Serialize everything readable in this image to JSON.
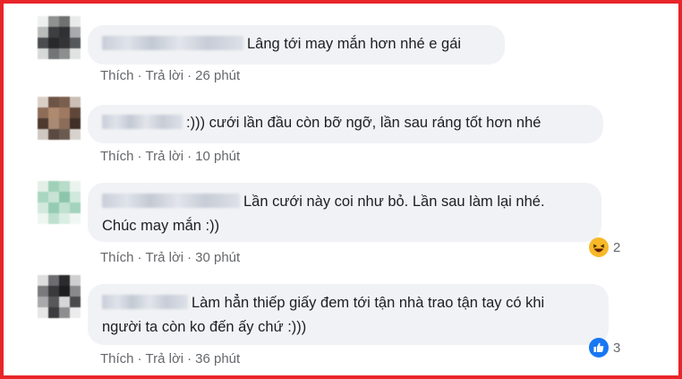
{
  "comments": [
    {
      "text": "Lâng tới may mắn hơn nhé e gái",
      "actions": {
        "like": "Thích",
        "reply": "Trả lời",
        "time": "26 phút"
      }
    },
    {
      "text": ":))) cưới lần đầu còn bỡ ngỡ, lần sau ráng tốt hơn nhé",
      "actions": {
        "like": "Thích",
        "reply": "Trả lời",
        "time": "10 phút"
      }
    },
    {
      "text_line1": "Lần cưới này coi như bỏ. Lần sau làm lại nhé.",
      "text_line2": "Chúc may mắn :))",
      "actions": {
        "like": "Thích",
        "reply": "Trả lời",
        "time": "30 phút"
      },
      "reaction": {
        "icon": "haha-reaction-icon",
        "count": "2"
      }
    },
    {
      "text_line1": "Làm hẳn thiếp giấy đem tới tận nhà trao tận tay có khi",
      "text_line2": "người ta còn ko đến ấy chứ :)))",
      "actions": {
        "like": "Thích",
        "reply": "Trả lời",
        "time": "36 phút"
      },
      "reaction": {
        "icon": "like-reaction-icon",
        "count": "3"
      }
    }
  ],
  "separator": "·",
  "colors": {
    "frame_border": "#e8262a",
    "bubble": "#f0f2f5",
    "text": "#1c1e21",
    "meta": "#65676b",
    "like_blue": "#1877f2",
    "haha_yellow": "#f7b928"
  }
}
